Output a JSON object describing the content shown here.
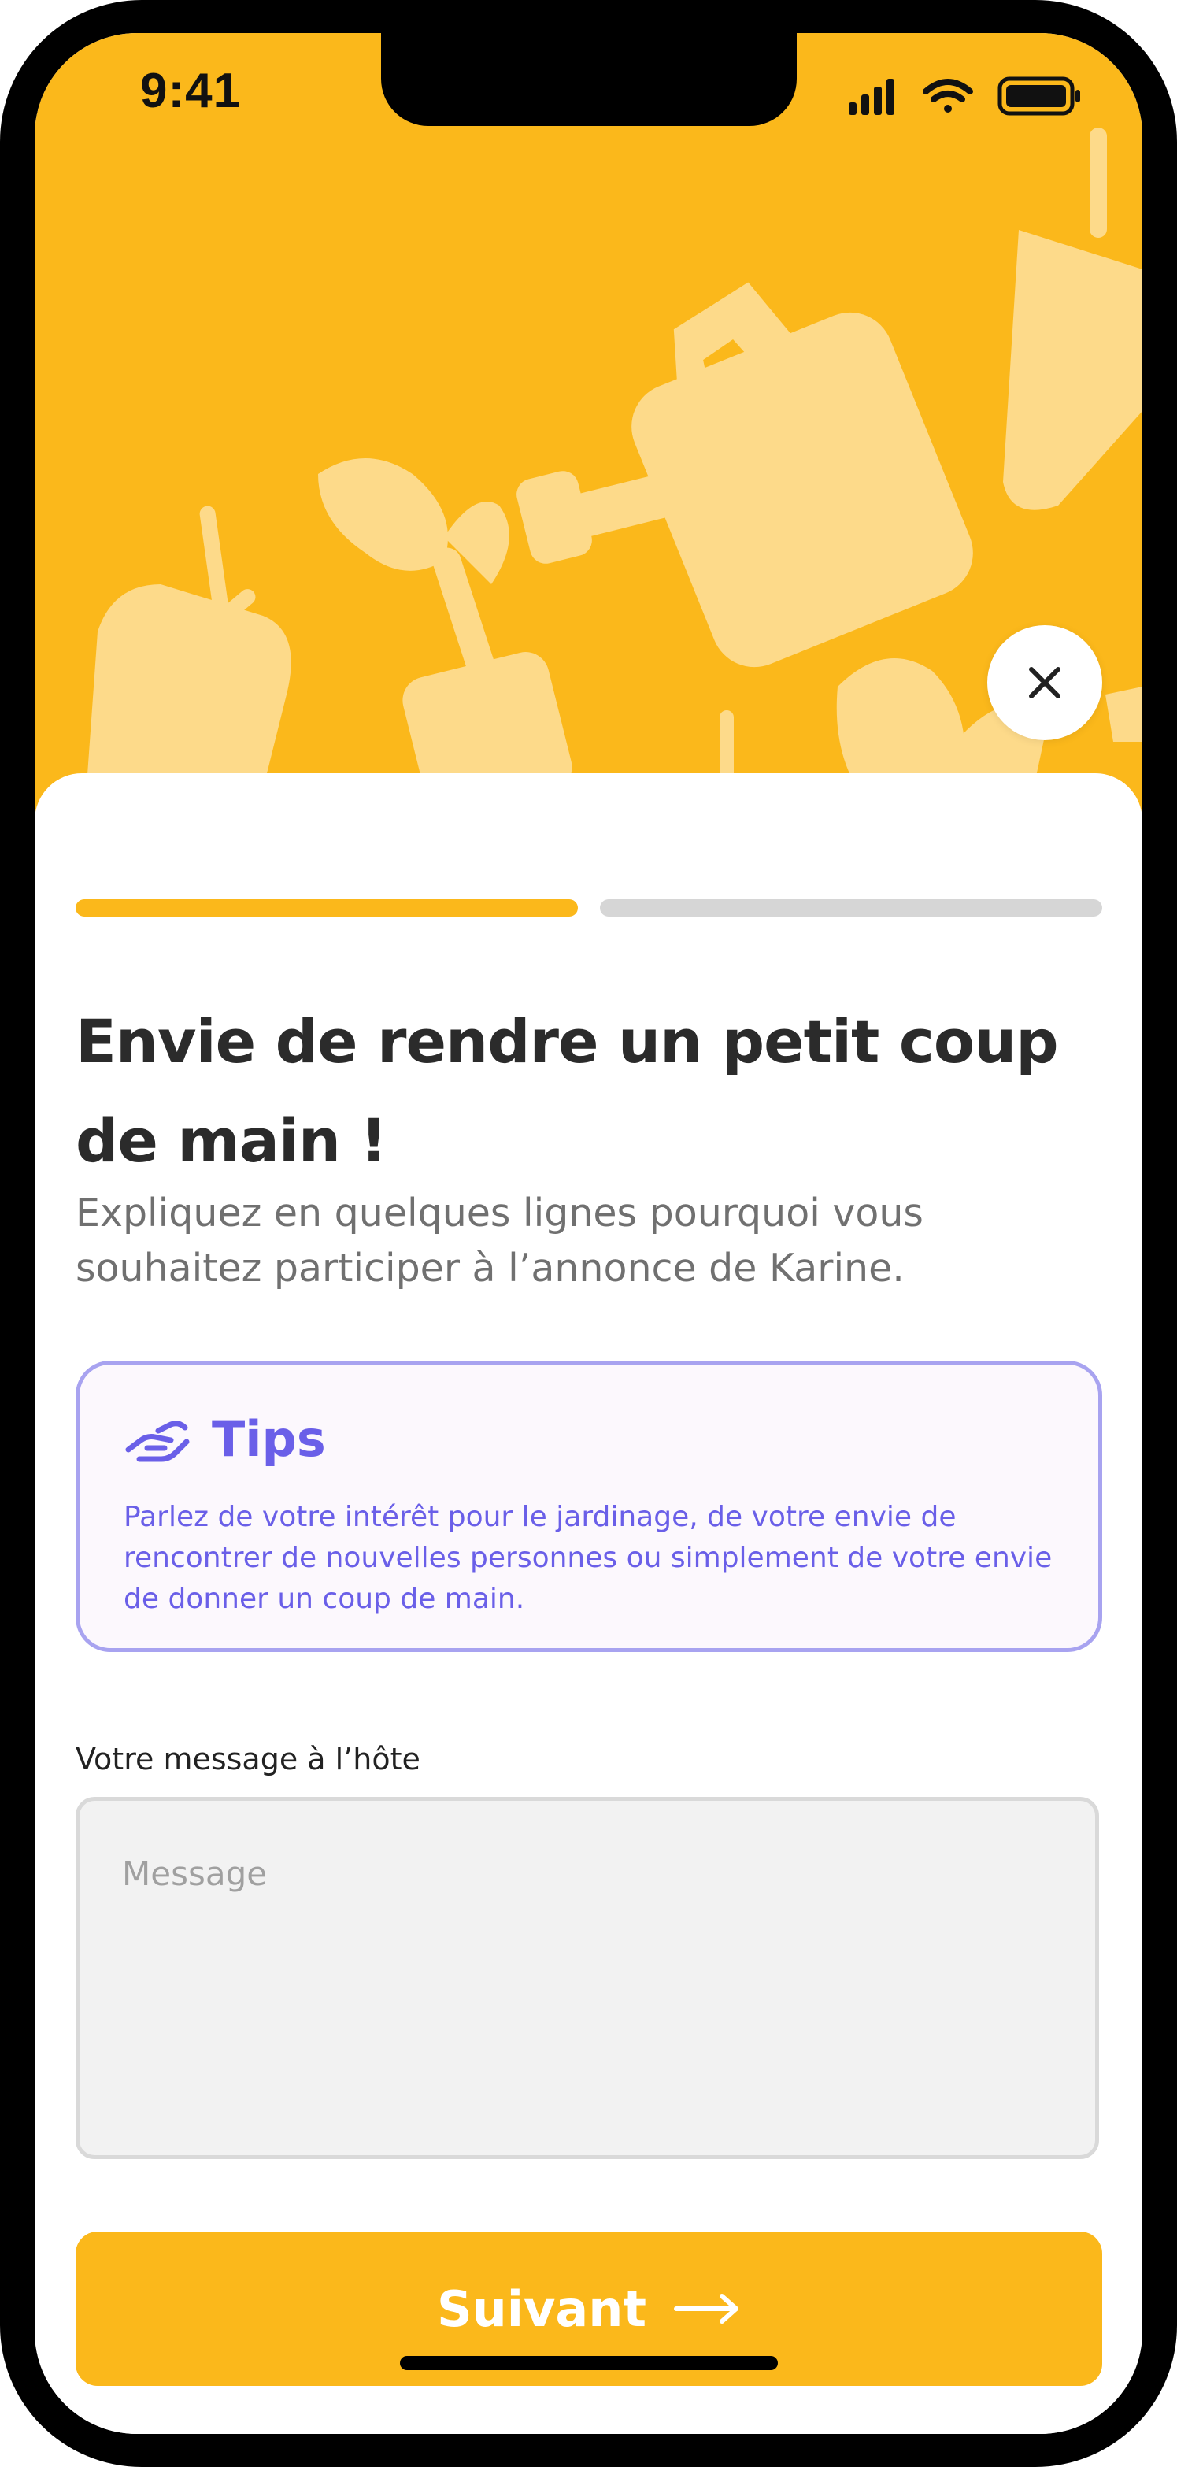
{
  "status_bar": {
    "time": "9:41"
  },
  "hero": {
    "background_color": "#FBB81B",
    "illustrations": [
      "watering-can",
      "carrot",
      "radish",
      "sprout-in-pot",
      "leaves"
    ],
    "close_icon": "close-icon"
  },
  "progress": {
    "current_step": 1,
    "total_steps": 2,
    "active_color": "#FBB81B",
    "inactive_color": "#D6D6D6"
  },
  "content": {
    "title": "Envie de rendre un petit coup de main !",
    "subtitle": "Expliquez en quelques lignes pourquoi vous souhaitez participer à l’annonce de Karine."
  },
  "tips": {
    "icon": "helping-hand-icon",
    "title": "Tips",
    "text": "Parlez de votre intérêt pour le jardinage, de votre envie de rencontrer de nouvelles personnes ou simplement de votre envie de donner un coup de main.",
    "accent_color": "#6A5FE8"
  },
  "form": {
    "message_label": "Votre message à l’hôte",
    "message_value": "",
    "message_placeholder": "Message"
  },
  "actions": {
    "next_label": "Suivant",
    "next_icon": "arrow-right-icon"
  }
}
